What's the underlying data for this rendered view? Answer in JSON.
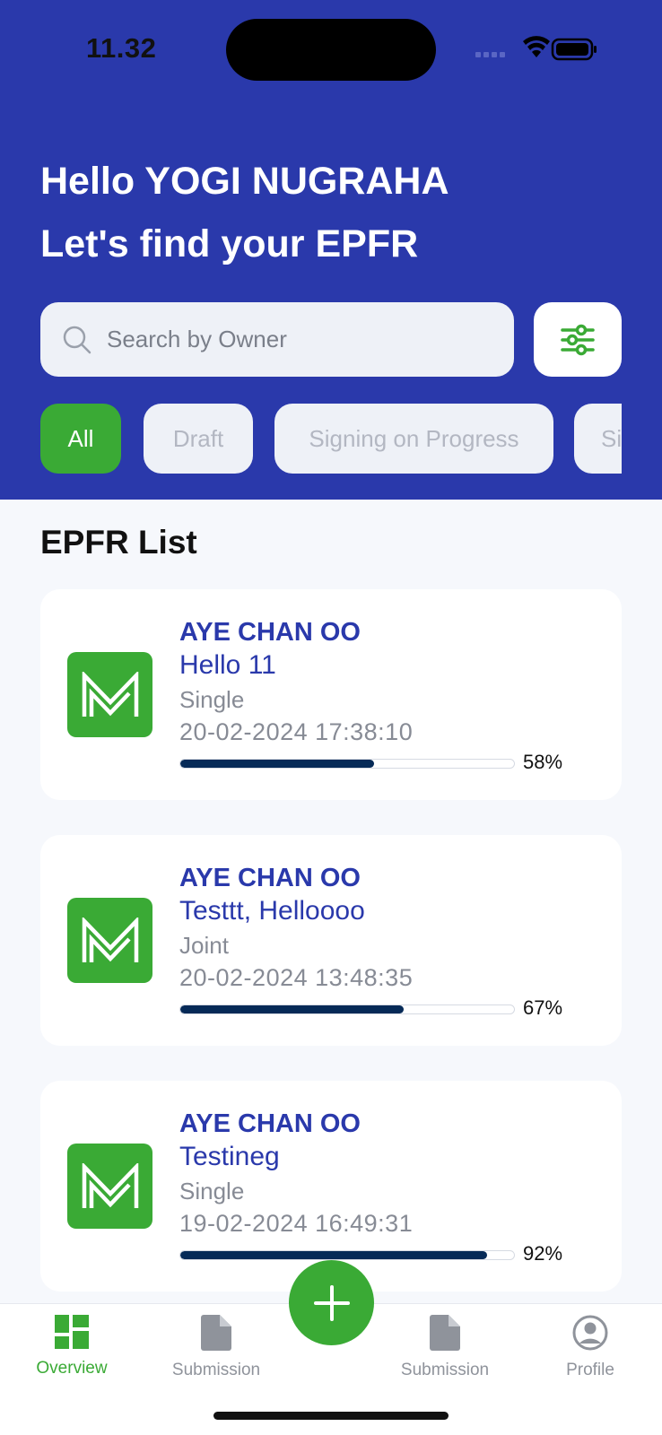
{
  "status_bar": {
    "time": "11.32",
    "wifi_icon": "wifi-icon",
    "battery_icon": "battery-icon"
  },
  "header": {
    "greeting": "Hello YOGI NUGRAHA",
    "subtitle": "Let's find your EPFR",
    "search": {
      "placeholder": "Search by Owner",
      "value": "",
      "icon": "search-icon"
    },
    "filter_icon": "sliders-icon",
    "chips": [
      {
        "label": "All",
        "active": true
      },
      {
        "label": "Draft",
        "active": false
      },
      {
        "label": "Signing on Progress",
        "active": false
      },
      {
        "label": "Si",
        "active": false
      }
    ]
  },
  "list": {
    "title": "EPFR List",
    "items": [
      {
        "owner": "AYE CHAN OO",
        "name": "Hello 11",
        "type": "Single",
        "date": "20-02-2024 17:38:10",
        "progress": 58,
        "progress_label": "58%"
      },
      {
        "owner": "AYE CHAN OO",
        "name": "Testtt, Helloooo",
        "type": "Joint",
        "date": "20-02-2024 13:48:35",
        "progress": 67,
        "progress_label": "67%"
      },
      {
        "owner": "AYE CHAN OO",
        "name": "Testineg",
        "type": "Single",
        "date": "19-02-2024 16:49:31",
        "progress": 92,
        "progress_label": "92%"
      }
    ]
  },
  "bottom_nav": {
    "items": [
      {
        "label": "Overview",
        "icon": "dashboard-icon",
        "active": true
      },
      {
        "label": "Submission",
        "icon": "document-icon",
        "active": false
      },
      {
        "label": "Submission",
        "icon": "document-icon",
        "active": false
      },
      {
        "label": "Profile",
        "icon": "profile-icon",
        "active": false
      }
    ],
    "fab_icon": "plus-icon"
  },
  "colors": {
    "primary": "#2a39ab",
    "accent": "#3aaa35",
    "progress": "#062a57"
  }
}
